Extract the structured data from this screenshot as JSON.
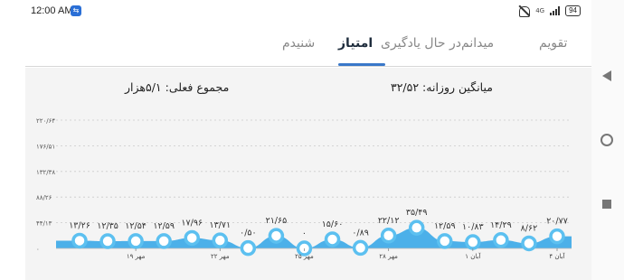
{
  "status_bar": {
    "time": "12:00 AM",
    "app_badge": "⇆",
    "signal_text": "4G",
    "battery": "94"
  },
  "tabs": [
    {
      "label": "تقویم",
      "active": false
    },
    {
      "label": "میدانم",
      "active": false
    },
    {
      "label": "در حال یادگیری",
      "active": false
    },
    {
      "label": "امتیاز",
      "active": true
    },
    {
      "label": "شنیدم",
      "active": false
    }
  ],
  "summary": {
    "total": "مجموع فعلی: ۵/۱هزار",
    "daily_avg": "میانگین روزانه: ۳۲/۵۲"
  },
  "chart_data": {
    "type": "area",
    "y_ticks": [
      "۲۲۰/۶۴",
      "۱۷۶/۵۱",
      "۱۳۲/۳۸",
      "۸۸/۲۶",
      "۴۴/۱۳",
      "۰"
    ],
    "ylim": [
      0,
      220.64
    ],
    "grid": true,
    "color": "#5cc0f0",
    "fill_color": "#3aa8e8",
    "points": [
      {
        "value": 13.26,
        "label": "۱۳/۲۶"
      },
      {
        "value": 12.35,
        "label": "۱۲/۳۵"
      },
      {
        "value": 12.54,
        "label": "۱۲/۵۴"
      },
      {
        "value": 12.59,
        "label": "۱۲/۵۹"
      },
      {
        "value": 17.96,
        "label": "۱۷/۹۶"
      },
      {
        "value": 13.71,
        "label": "۱۳/۷۱"
      },
      {
        "value": 0.5,
        "label": "۰/۵۰"
      },
      {
        "value": 21.65,
        "label": "۲۱/۶۵"
      },
      {
        "value": 0,
        "label": "۰"
      },
      {
        "value": 15.6,
        "label": "۱۵/۶۰"
      },
      {
        "value": 0.89,
        "label": "۰/۸۹"
      },
      {
        "value": 22.12,
        "label": "۲۲/۱۲"
      },
      {
        "value": 35.49,
        "label": "۳۵/۴۹"
      },
      {
        "value": 12.59,
        "label": "۱۲/۵۹"
      },
      {
        "value": 10.83,
        "label": "۱۰/۸۳"
      },
      {
        "value": 14.29,
        "label": "۱۴/۲۹"
      },
      {
        "value": 8.62,
        "label": "۸/۶۲"
      },
      {
        "value": 20.77,
        "label": "۲۰/۷۷"
      }
    ],
    "x_labels": [
      {
        "index": 2,
        "label": "۱۹ مهر"
      },
      {
        "index": 5,
        "label": "۲۲ مهر"
      },
      {
        "index": 8,
        "label": "۲۵ مهر"
      },
      {
        "index": 11,
        "label": "۲۸ مهر"
      },
      {
        "index": 14,
        "label": "۱ آبان"
      },
      {
        "index": 17,
        "label": "۴ آبان"
      }
    ]
  }
}
